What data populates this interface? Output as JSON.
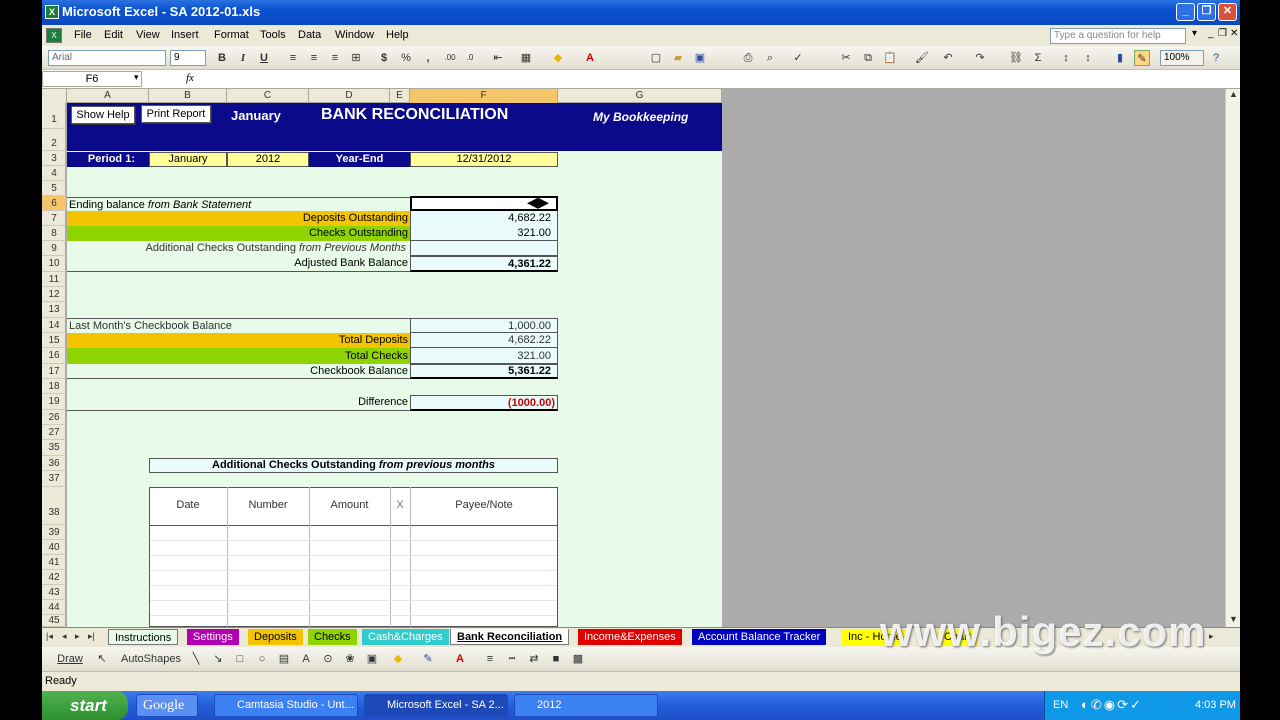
{
  "window": {
    "title": "Microsoft Excel - SA 2012-01.xls",
    "controls": {
      "minimize": "_",
      "restore": "❐",
      "close": "✕"
    }
  },
  "menu": {
    "items": [
      "File",
      "Edit",
      "View",
      "Insert",
      "Format",
      "Tools",
      "Data",
      "Window",
      "Help"
    ],
    "help_placeholder": "Type a question for help"
  },
  "toolbar": {
    "font": "Arial",
    "size": "9",
    "bold": "B",
    "italic": "I",
    "underline": "U",
    "currency": "$",
    "percent": "%",
    "comma": ",",
    "sum": "Σ",
    "zoom": "100%"
  },
  "formula_bar": {
    "name_box": "F6",
    "fx": "fx",
    "content": ""
  },
  "columns": [
    "A",
    "B",
    "C",
    "D",
    "E",
    "F",
    "G"
  ],
  "rows": [
    "1",
    "2",
    "3",
    "4",
    "5",
    "6",
    "7",
    "8",
    "9",
    "10",
    "11",
    "12",
    "13",
    "14",
    "15",
    "16",
    "17",
    "18",
    "19",
    "26",
    "27",
    "35",
    "36",
    "37",
    "38",
    "39",
    "40",
    "41",
    "42",
    "43",
    "44",
    "45"
  ],
  "sheet": {
    "show_help": "Show Help",
    "print_report": "Print Report",
    "month": "January",
    "title": "BANK RECONCILIATION",
    "brand": "My Bookkeeping",
    "period_label": "Period 1:",
    "period_month": "January",
    "period_year": "2012",
    "year_end_label": "Year-End",
    "year_end_value": "12/31/2012",
    "ending_balance": "Ending balance",
    "from_bank_statement": "from Bank Statement",
    "deposits_outstanding": "Deposits Outstanding",
    "deposits_outstanding_value": "4,682.22",
    "checks_outstanding": "Checks Outstanding",
    "checks_outstanding_value": "321.00",
    "additional_checks": "Additional Checks Outstanding",
    "from_previous_months": "from Previous Months",
    "adjusted_bank_balance": "Adjusted Bank Balance",
    "adjusted_bank_balance_value": "4,361.22",
    "last_month_balance": "Last Month's Checkbook Balance",
    "last_month_balance_value": "1,000.00",
    "total_deposits": "Total Deposits",
    "total_deposits_value": "4,682.22",
    "total_checks": "Total Checks",
    "total_checks_value": "321.00",
    "checkbook_balance": "Checkbook Balance",
    "checkbook_balance_value": "5,361.22",
    "difference": "Difference",
    "difference_value": "(1000.00)",
    "additional_table_title": "Additional Checks Outstanding",
    "additional_table_title_italic": "from previous months",
    "table_headers": [
      "Date",
      "Number",
      "Amount",
      "X",
      "Payee/Note"
    ]
  },
  "sheet_tabs": [
    {
      "label": "Instructions",
      "color": "#e8fbe8"
    },
    {
      "label": "Settings",
      "color": "#b000b0"
    },
    {
      "label": "Deposits",
      "color": "#f5c400"
    },
    {
      "label": "Checks",
      "color": "#8fd400"
    },
    {
      "label": "Cash&Charges",
      "color": "#33cccc"
    },
    {
      "label": "Bank Reconciliation",
      "color": "#ffffff"
    },
    {
      "label": "Income&Expenses",
      "color": "#e00000"
    },
    {
      "label": "Account Balance Tracker",
      "color": "#0000c0"
    },
    {
      "label": "Inc - Home",
      "color": "#ffff00"
    },
    {
      "label": "Chart",
      "color": "#ffff00"
    }
  ],
  "draw_toolbar": {
    "draw": "Draw",
    "autoshapes": "AutoShapes"
  },
  "status": "Ready",
  "taskbar": {
    "start": "start",
    "google": "Google",
    "tasks": [
      "Camtasia Studio - Unt...",
      "Microsoft Excel - SA 2...",
      "2012"
    ],
    "lang": "EN",
    "clock": "4:03 PM"
  },
  "watermark": "www.bigez.com"
}
